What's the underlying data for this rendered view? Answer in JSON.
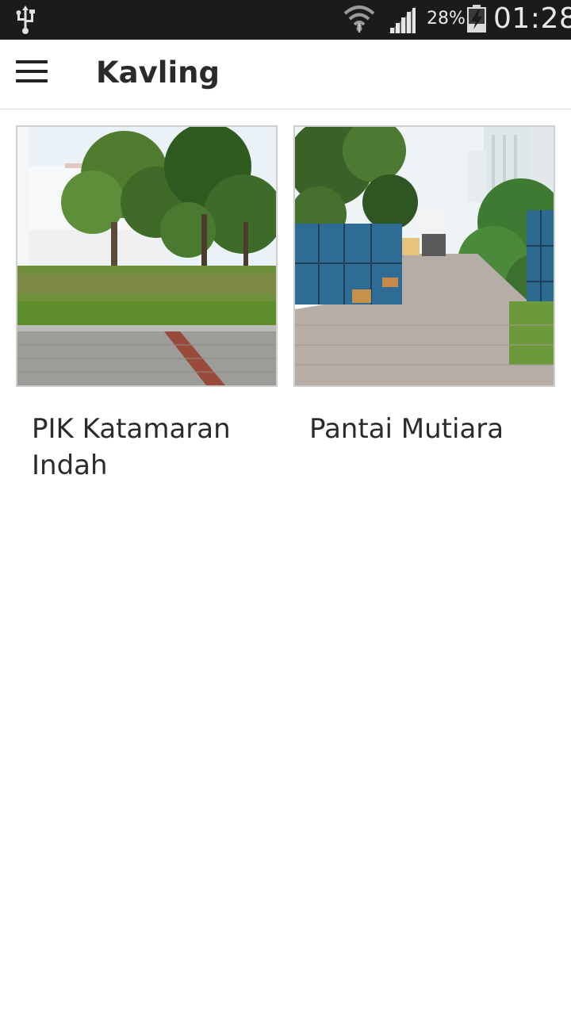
{
  "status_bar": {
    "battery_percent": "28%",
    "time": "01:28",
    "icons": [
      "usb-icon",
      "wifi-icon",
      "signal-icon",
      "battery-charging-icon"
    ]
  },
  "app_bar": {
    "menu_icon": "menu-icon",
    "title": "Kavling"
  },
  "listings": [
    {
      "title": "PIK Katamaran Indah",
      "image": "vacant-lot-photo"
    },
    {
      "title": "Pantai Mutiara",
      "image": "gated-lane-photo"
    }
  ]
}
